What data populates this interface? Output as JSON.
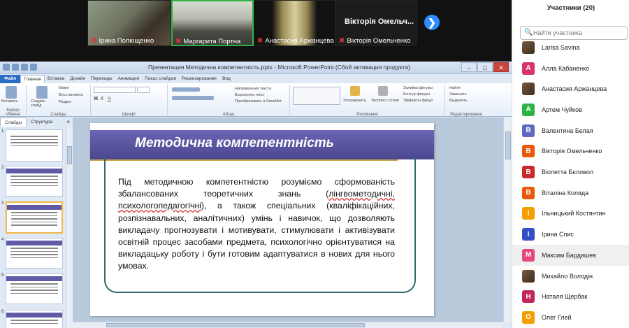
{
  "video_tiles": [
    {
      "name": "Ірина Полющенко",
      "muted": true
    },
    {
      "name": "Маргарита Портна",
      "muted": true
    },
    {
      "name": "Анастасия Аржанцева",
      "muted": true
    },
    {
      "name": "Вікторія Омельченко",
      "muted": true,
      "big_label": "Віктopiя Омельч..."
    }
  ],
  "next_arrow": "❯",
  "ppt": {
    "window_title": "Презентация Методична компетентність.pptx - Microsoft PowerPoint (Сбой активации продукта)",
    "tabs": [
      "Файл",
      "Главная",
      "Вставка",
      "Дизайн",
      "Переходы",
      "Анимация",
      "Показ слайдов",
      "Рецензирование",
      "Вид"
    ],
    "active_tab": "Главная",
    "ribbon_groups": [
      "Буфер обмена",
      "Слайды",
      "Шрифт",
      "Абзац",
      "Рисование",
      "Редактирование"
    ],
    "ribbon_items": {
      "paste": "Вставить",
      "create_slide": "Создать слайд",
      "layout": "Макет",
      "restore": "Восстановить",
      "section": "Раздел",
      "text_direction": "Направление текста",
      "align_text": "Выровнять текст",
      "smartart": "Преобразовать в SmartArt",
      "arrange": "Упорядочить",
      "express_styles": "Экспресс-стили",
      "shape_fill": "Заливка фигуры",
      "shape_outline": "Контур фигуры",
      "shape_effects": "Эффекты фигур",
      "find": "Найти",
      "replace": "Заменить",
      "select": "Выделить"
    },
    "panel_tabs": [
      "Слайды",
      "Структура"
    ],
    "panel_close": "×",
    "thumb_numbers": [
      "1",
      "2",
      "3",
      "4",
      "5",
      "6"
    ],
    "slide": {
      "title": "Методична компетентність",
      "body_pre": "Під методичною компетентністю розуміємо сформованість збалансованих теоретичних знань (",
      "body_und": "лінгвометодичні, психологопедагогічні",
      "body_post": "), а також спеціальних (кваліфікаційних, розпізнавальних, аналітичних) умінь і навичок, що дозволяють викладачу прогнозувати і мотивувати, стимулювати і активізувати освітній процес засобами предмета, психологічно орієнтуватися на викладацьку роботу і бути готовим адаптуватися в нових для нього умовах."
    }
  },
  "participants": {
    "header": "Участники (20)",
    "search_placeholder": "Найти участника",
    "search_icon": "🔍",
    "list": [
      {
        "name": "Larisa Savina",
        "initial": "",
        "color": "#8b6a4f",
        "photo": true
      },
      {
        "name": "Алла Кабаненко",
        "initial": "А",
        "color": "#d6336c"
      },
      {
        "name": "Анастасия Аржанцева",
        "initial": "",
        "color": "#6b5a4a",
        "photo": true
      },
      {
        "name": "Артем Чуйков",
        "initial": "А",
        "color": "#2fb344"
      },
      {
        "name": "Валентина Белая",
        "initial": "В",
        "color": "#5c6bc0"
      },
      {
        "name": "Вікторія Омельченко",
        "initial": "В",
        "color": "#e8590c"
      },
      {
        "name": "Віолетта Бєловол",
        "initial": "В",
        "color": "#c92a2a"
      },
      {
        "name": "Віталіна Коляда",
        "initial": "В",
        "color": "#e8590c"
      },
      {
        "name": "Ільницький Костянтин",
        "initial": "І",
        "color": "#f59f00"
      },
      {
        "name": "Ірина Спис",
        "initial": "І",
        "color": "#364fc7"
      },
      {
        "name": "Максим Бардишев",
        "initial": "М",
        "color": "#e64980"
      },
      {
        "name": "Михайло Володін",
        "initial": "",
        "color": "#3b2c20",
        "photo": true
      },
      {
        "name": "Наталя Щербак",
        "initial": "Н",
        "color": "#c2255c"
      },
      {
        "name": "Олег Глей",
        "initial": "О",
        "color": "#f59f00"
      }
    ]
  }
}
